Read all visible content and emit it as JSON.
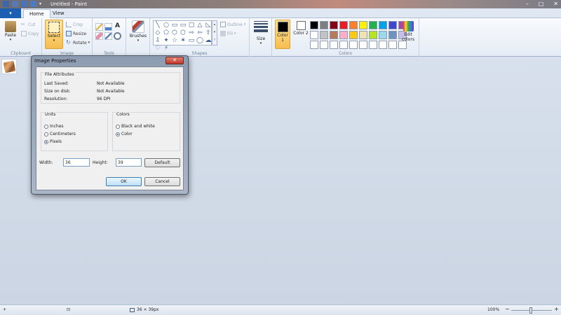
{
  "window": {
    "title": "Untitled - Paint",
    "controls": [
      "–",
      "□",
      "✕"
    ]
  },
  "tabs": {
    "file_label": "▾",
    "items": [
      "Home",
      "View"
    ]
  },
  "ribbon": {
    "clipboard": {
      "label": "Clipboard",
      "paste": "Paste",
      "cut": "Cut",
      "copy": "Copy"
    },
    "image": {
      "label": "Image",
      "select": "Select",
      "crop": "Crop",
      "resize": "Resize",
      "rotate": "Rotate"
    },
    "tools": {
      "label": "Tools",
      "text_tool": "A"
    },
    "brushes": {
      "label": "Brushes"
    },
    "shapes": {
      "label": "Shapes",
      "outline": "Outline",
      "fill": "Fill",
      "glyphs": [
        "╲",
        "○",
        "▭",
        "▭",
        "▢",
        "△",
        "◺",
        "◇",
        "⬠",
        "⬡",
        "⬡",
        "⇨",
        "⇦",
        "⇧",
        "⇩",
        "✦",
        "☆",
        "✶",
        "▭",
        "◯",
        "☁",
        "♡",
        "⚡",
        "",
        "",
        "",
        ""
      ]
    },
    "size": {
      "label": "Size"
    },
    "colors": {
      "label": "Colors",
      "color1": "Color 1",
      "color2": "Color 2",
      "edit_colors": "Edit colors",
      "color1_value": "#000000",
      "color2_value": "#ffffff",
      "palette": [
        "#000000",
        "#7f7f7f",
        "#880015",
        "#ed1c24",
        "#ff7f27",
        "#fff200",
        "#22b14c",
        "#00a2e8",
        "#3f48cc",
        "#a349a4",
        "#ffffff",
        "#c3c3c3",
        "#b97a57",
        "#ffaec9",
        "#ffc90e",
        "#efe4b0",
        "#b5e61d",
        "#99d9ea",
        "#7092be",
        "#c8bfe7",
        "#ffffff",
        "#ffffff",
        "#ffffff",
        "#ffffff",
        "#ffffff",
        "#ffffff",
        "#ffffff",
        "#ffffff",
        "#ffffff",
        "#ffffff"
      ]
    }
  },
  "dialog": {
    "title": "Image Properties",
    "close": "✕",
    "file_attributes": {
      "legend": "File Attributes",
      "rows": [
        {
          "key": "Last Saved:",
          "value": "Not Available"
        },
        {
          "key": "Size on disk:",
          "value": "Not Available"
        },
        {
          "key": "Resolution:",
          "value": "96 DPI"
        }
      ]
    },
    "units": {
      "legend": "Units",
      "options": [
        "Inches",
        "Centimeters",
        "Pixels"
      ],
      "selected": "Pixels"
    },
    "colors": {
      "legend": "Colors",
      "options": [
        "Black and white",
        "Color"
      ],
      "selected": "Color"
    },
    "width_label": "Width:",
    "width_value": "36",
    "height_label": "Height:",
    "height_value": "39",
    "default_button": "Default",
    "ok_button": "OK",
    "cancel_button": "Cancel"
  },
  "status": {
    "add_icon": "+",
    "selection_icon": "⊡",
    "image_size": "36 × 39px",
    "zoom": "100%",
    "zoom_out": "−",
    "zoom_in": "+"
  }
}
